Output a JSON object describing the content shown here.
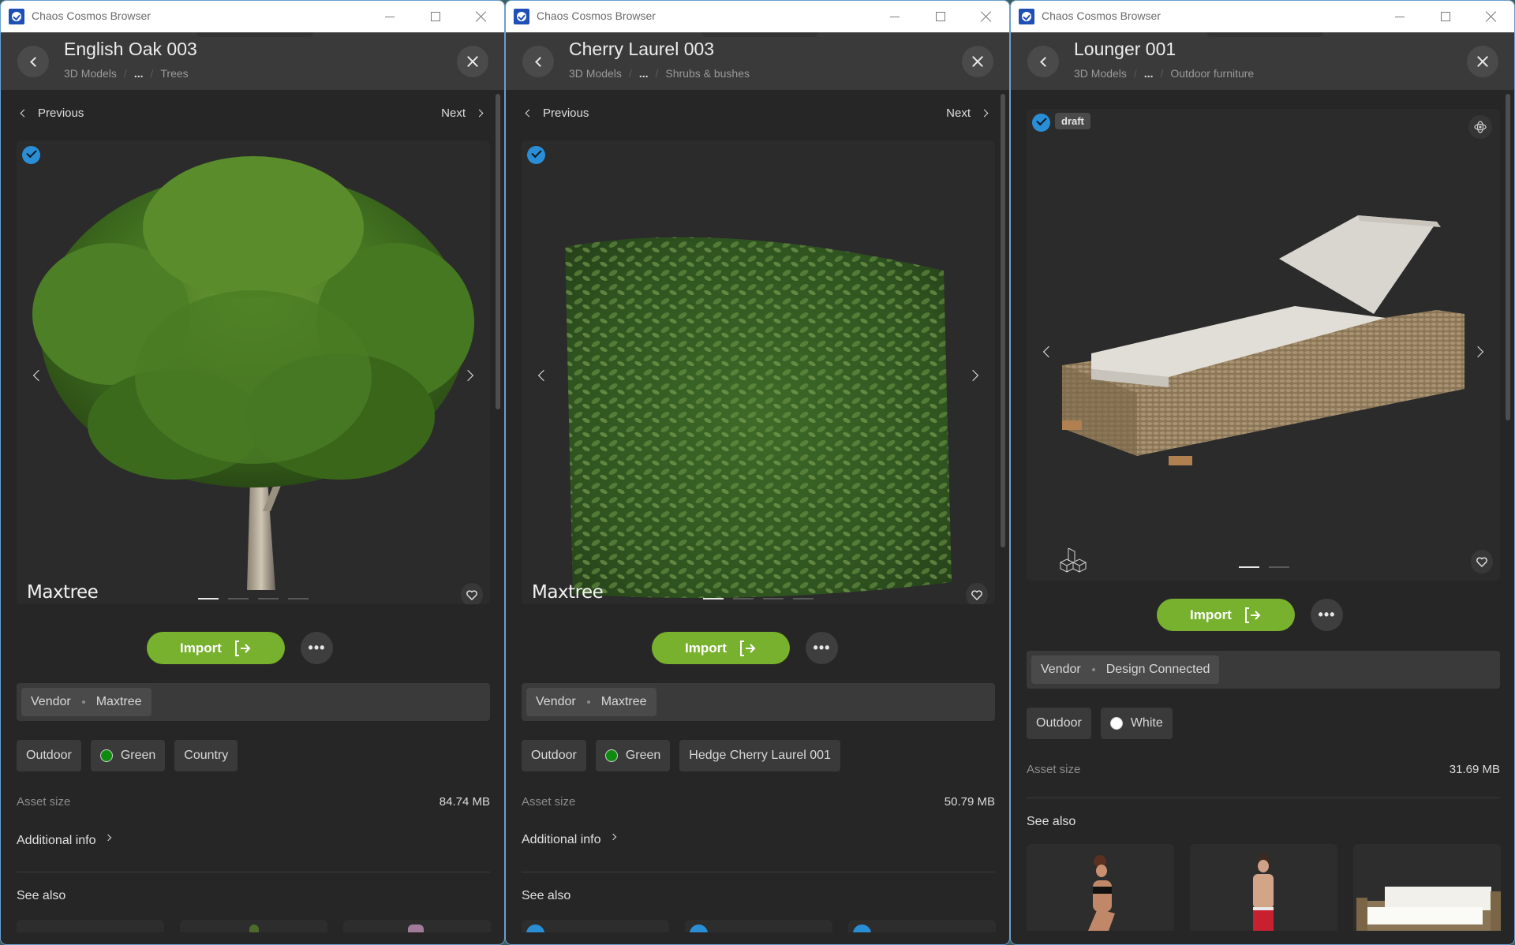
{
  "app": {
    "window_title": "Chaos Cosmos Browser"
  },
  "colors": {
    "accent_green": "#78b12d",
    "check_blue": "#2a8ed6",
    "swatch_green": "#0e8a0e",
    "swatch_white": "#ffffff"
  },
  "icons": {
    "back": "chevron-left-icon",
    "close": "close-icon",
    "previous": "chevron-left-icon",
    "next": "chevron-right-icon",
    "import": "import-arrow-icon",
    "more": "ellipsis-icon",
    "favorite": "heart-icon",
    "selected": "check-circle-icon",
    "orbit": "orbit-3d-icon",
    "model3d": "3d-cubes-icon"
  },
  "windows": [
    {
      "title": "English Oak 003",
      "breadcrumbs": [
        "3D Models",
        "...",
        "Trees"
      ],
      "nav": {
        "previous": "Previous",
        "next": "Next"
      },
      "vendor_logo": "Maxtree",
      "carousel": {
        "count": 4,
        "active": 1
      },
      "import_label": "Import",
      "more_label": "•••",
      "vendor": {
        "label": "Vendor",
        "value": "Maxtree"
      },
      "tags": [
        {
          "label": "Outdoor"
        },
        {
          "label": "Green",
          "swatch": "#0e8a0e"
        },
        {
          "label": "Country"
        }
      ],
      "asset_size": {
        "label": "Asset size",
        "value": "84.74 MB"
      },
      "additional_info": "Additional info",
      "see_also": "See also"
    },
    {
      "title": "Cherry Laurel 003",
      "breadcrumbs": [
        "3D Models",
        "...",
        "Shrubs & bushes"
      ],
      "nav": {
        "previous": "Previous",
        "next": "Next"
      },
      "vendor_logo": "Maxtree",
      "carousel": {
        "count": 4,
        "active": 1
      },
      "import_label": "Import",
      "more_label": "•••",
      "vendor": {
        "label": "Vendor",
        "value": "Maxtree"
      },
      "tags": [
        {
          "label": "Outdoor"
        },
        {
          "label": "Green",
          "swatch": "#0e8a0e"
        },
        {
          "label": "Hedge Cherry Laurel 001"
        }
      ],
      "asset_size": {
        "label": "Asset size",
        "value": "50.79 MB"
      },
      "additional_info": "Additional info",
      "see_also": "See also"
    },
    {
      "title": "Lounger 001",
      "breadcrumbs": [
        "3D Models",
        "...",
        "Outdoor furniture"
      ],
      "badge": "draft",
      "carousel": {
        "count": 2,
        "active": 1
      },
      "import_label": "Import",
      "more_label": "•••",
      "vendor": {
        "label": "Vendor",
        "value": "Design Connected"
      },
      "tags": [
        {
          "label": "Outdoor"
        },
        {
          "label": "White",
          "swatch": "#ffffff"
        }
      ],
      "asset_size": {
        "label": "Asset size",
        "value": "31.69 MB"
      },
      "see_also": "See also"
    }
  ]
}
